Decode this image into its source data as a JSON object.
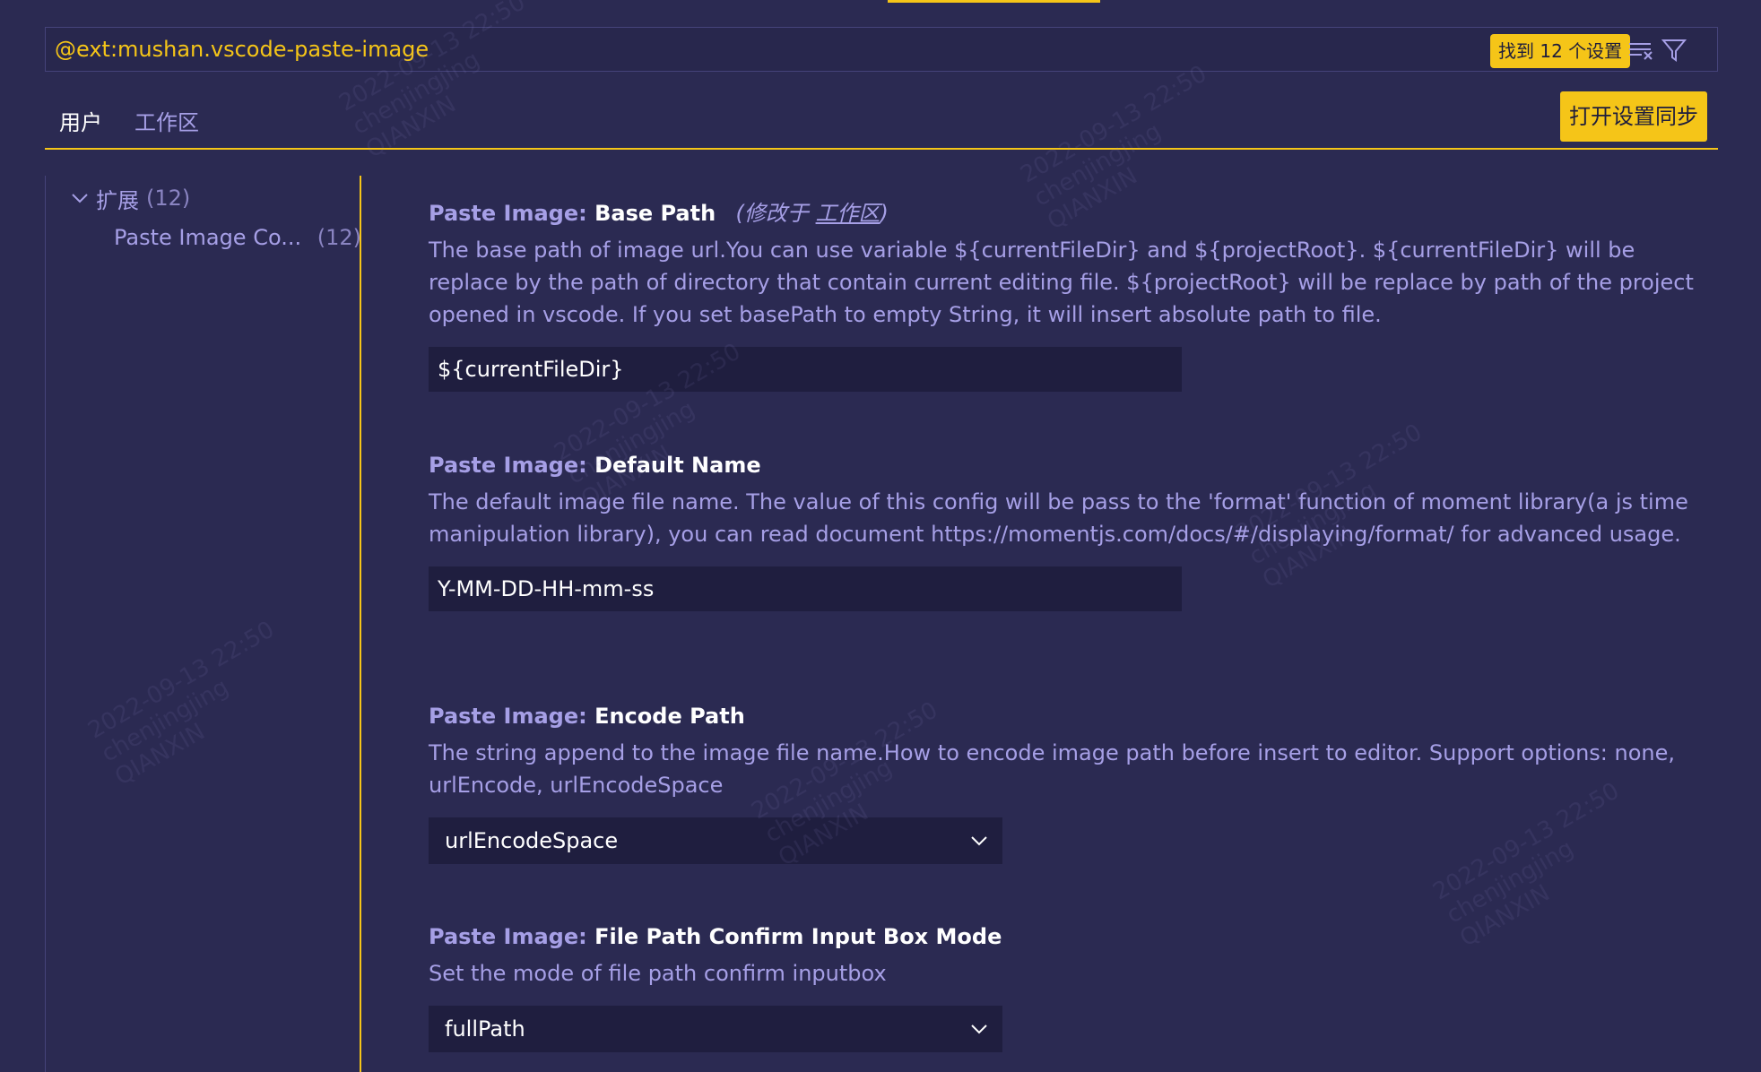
{
  "search": {
    "query": "@ext:mushan.vscode-paste-image",
    "found_label": "找到 12 个设置",
    "clear_icon": "clear-filter-icon",
    "filter_icon": "filter-icon"
  },
  "tabs": [
    {
      "label": "用户",
      "active": true
    },
    {
      "label": "工作区",
      "active": false
    }
  ],
  "sync_button_label": "打开设置同步",
  "toc": {
    "group_label": "扩展",
    "group_count": "(12)",
    "items": [
      {
        "label": "Paste Image Co...",
        "count": "(12)"
      }
    ]
  },
  "settings": [
    {
      "category": "Paste Image:",
      "name": "Base Path",
      "modified_prefix": "(修改于 ",
      "modified_link": "工作区",
      "modified_suffix": ")",
      "description": "The base path of image url.You can use variable ${currentFileDir} and ${projectRoot}. ${currentFileDir} will be replace by the path of directory that contain current editing file. ${projectRoot} will be replace by path of the project opened in vscode. If you set basePath to empty String, it will insert absolute path to file.",
      "value": "${currentFileDir}"
    },
    {
      "category": "Paste Image:",
      "name": "Default Name",
      "description": "The default image file name. The value of this config will be pass to the 'format' function of moment library(a js time manipulation library), you can read document https://momentjs.com/docs/#/displaying/format/ for advanced usage.",
      "value": "Y-MM-DD-HH-mm-ss"
    },
    {
      "category": "Paste Image:",
      "name": "Encode Path",
      "description": "The string append to the image file name.How to encode image path before insert to editor. Support options: none, urlEncode, urlEncodeSpace",
      "value": "urlEncodeSpace"
    },
    {
      "category": "Paste Image:",
      "name": "File Path Confirm Input Box Mode",
      "description": "Set the mode of file path confirm inputbox",
      "value": "fullPath"
    }
  ],
  "watermark": {
    "date": "2022-09-13 22:50",
    "user": "chenjingjing",
    "org": "QIANXIN"
  },
  "colors": {
    "background": "#2b2a52",
    "accent": "#f5c518",
    "text": "#a69fe6",
    "input_bg": "#1f1e3f"
  }
}
